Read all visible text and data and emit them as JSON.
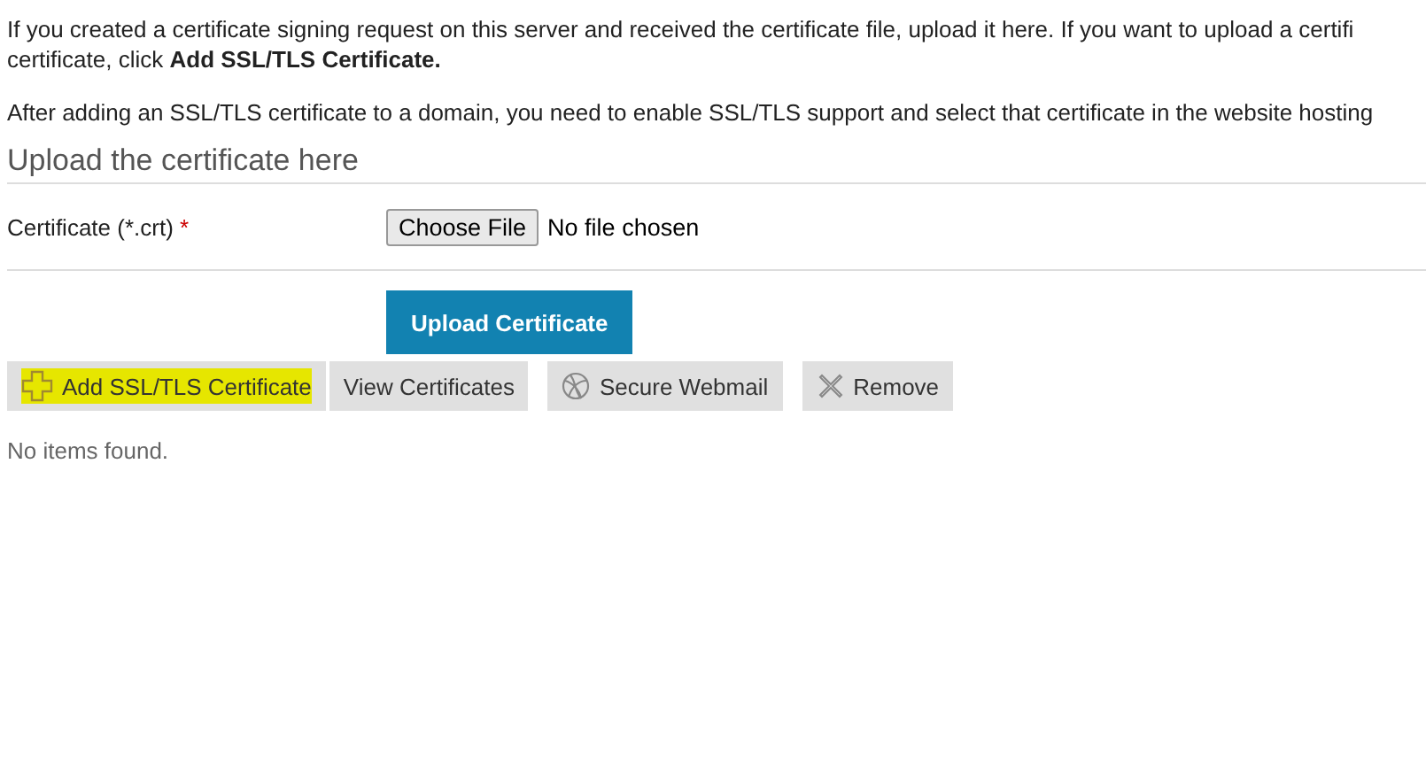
{
  "intro": {
    "lines": [
      "If you created a certificate signing request on this server and received the certificate file, upload it here. If you want to upload a certifi",
      "certificate, click **Add SSL/TLS Certificate.**"
    ]
  },
  "note": "After adding an SSL/TLS certificate to a domain, you need to enable SSL/TLS support and select that certificate in the website hosting",
  "section": {
    "title": "Upload the certificate here"
  },
  "field": {
    "label": "Certificate (*.crt)",
    "required_mark": "*",
    "button": "Choose File",
    "value": "No file chosen"
  },
  "submit": "Upload Certificate",
  "toolbar": [
    {
      "label": "Add SSL/TLS Certificate",
      "kind": "add",
      "highlighted": true
    },
    {
      "label": "View Certificates",
      "kind": "view",
      "highlighted": false
    },
    {
      "label": "Secure Webmail",
      "kind": "webmail",
      "highlighted": false
    },
    {
      "label": "Remove",
      "kind": "remove",
      "highlighted": false
    }
  ],
  "empty": "No items found."
}
